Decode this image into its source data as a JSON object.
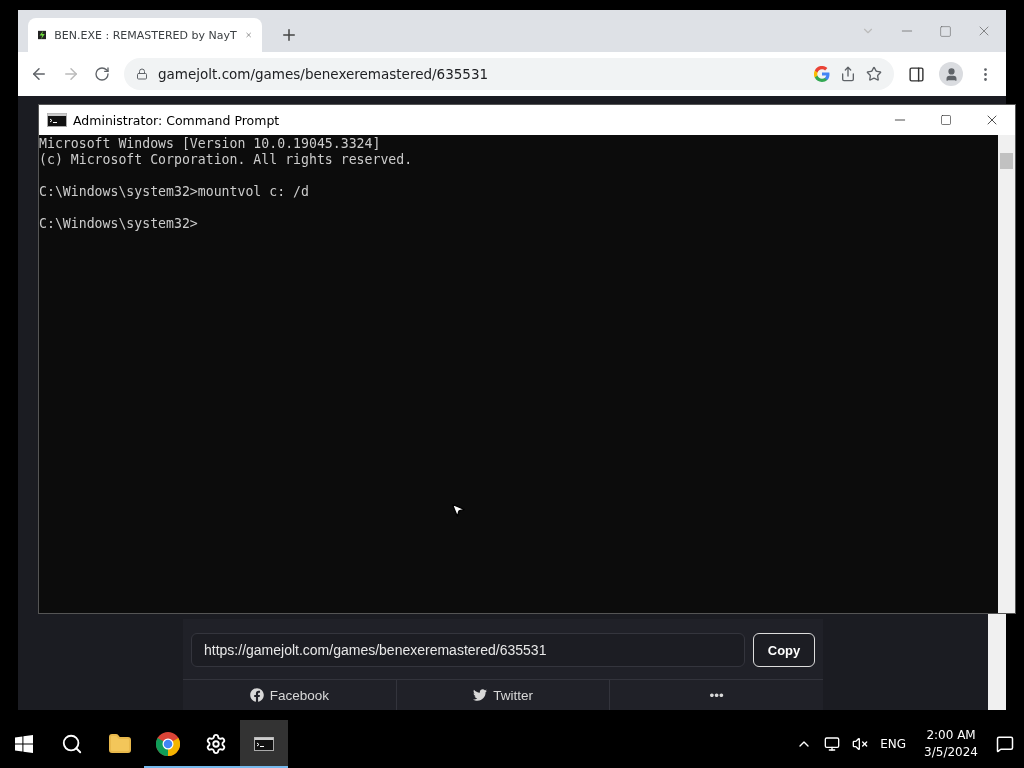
{
  "browser": {
    "tab": {
      "title": "BEN.EXE : REMASTERED by NayT",
      "selected": true
    },
    "address": "gamejolt.com/games/benexeremastered/635531",
    "share": {
      "url": "https://gamejolt.com/games/benexeremastered/635531",
      "copy_label": "Copy",
      "buttons": [
        {
          "kind": "facebook",
          "label": "Facebook"
        },
        {
          "kind": "twitter",
          "label": "Twitter"
        },
        {
          "kind": "more",
          "label": "•••"
        }
      ]
    }
  },
  "terminal": {
    "title": "Administrator: Command Prompt",
    "blocks": [
      {
        "lines": [
          "Microsoft Windows [Version 10.0.19045.3324]",
          "(c) Microsoft Corporation. All rights reserved."
        ]
      },
      {
        "lines": [
          "C:\\Windows\\system32>mountvol c: /d"
        ]
      },
      {
        "lines": [
          "C:\\Windows\\system32>"
        ]
      }
    ]
  },
  "taskbar": {
    "items": [
      {
        "kind": "start",
        "running": false,
        "selected": false
      },
      {
        "kind": "search",
        "running": false,
        "selected": false
      },
      {
        "kind": "explorer",
        "running": false,
        "selected": false
      },
      {
        "kind": "chrome",
        "running": true,
        "selected": false
      },
      {
        "kind": "settings",
        "running": true,
        "selected": false
      },
      {
        "kind": "terminal",
        "running": true,
        "selected": true
      }
    ],
    "language": "ENG",
    "time": "2:00 AM",
    "date": "3/5/2024"
  }
}
